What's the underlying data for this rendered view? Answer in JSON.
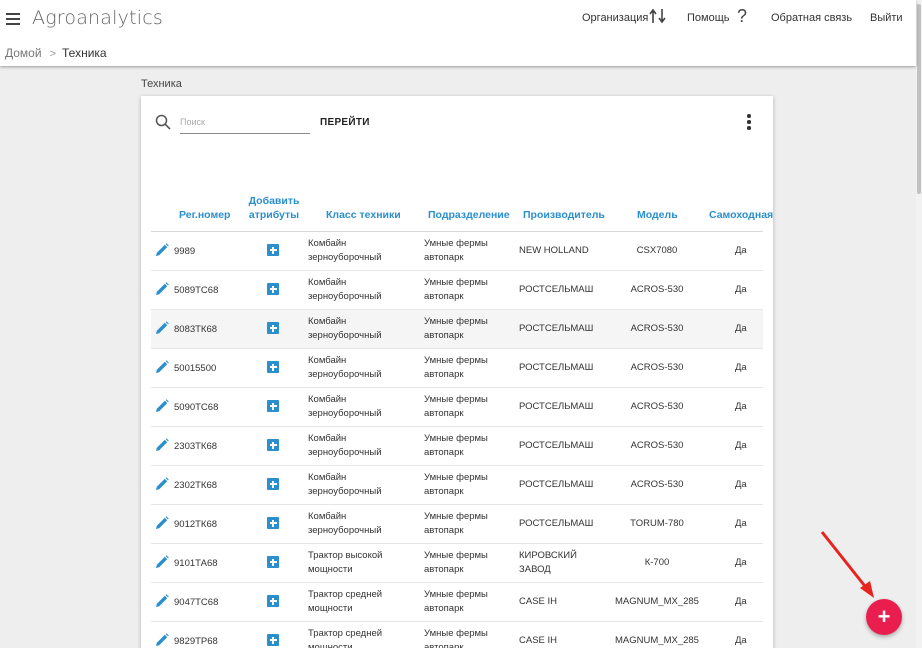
{
  "header": {
    "app_title": "Agroanalytics",
    "nav": {
      "organization": "Организация",
      "help": "Помощь",
      "help_glyph": "?",
      "feedback": "Обратная связь",
      "logout": "Выйти"
    }
  },
  "breadcrumb": {
    "home": "Домой",
    "separator": ">",
    "current": "Техника"
  },
  "section_label": "Техника",
  "toolbar": {
    "search_placeholder": "Поиск",
    "go_label": "ПЕРЕЙТИ"
  },
  "table": {
    "columns": {
      "reg": "Рег.номер",
      "add_attr_line1": "Добавить",
      "add_attr_line2": "атрибуты",
      "class": "Класс техники",
      "division": "Подразделение",
      "manufacturer": "Производитель",
      "model": "Модель",
      "self_propelled": "Самоходная"
    },
    "rows": [
      {
        "reg": "9989",
        "class1": "Комбайн",
        "class2": "зерноуборочный",
        "div1": "Умные фермы",
        "div2": "автопарк",
        "mfr1": "NEW HOLLAND",
        "mfr2": "",
        "model": "CSX7080",
        "self": "Да"
      },
      {
        "reg": "5089ТС68",
        "class1": "Комбайн",
        "class2": "зерноуборочный",
        "div1": "Умные фермы",
        "div2": "автопарк",
        "mfr1": "РОСТСЕЛЬМАШ",
        "mfr2": "",
        "model": "ACROS-530",
        "self": "Да"
      },
      {
        "reg": "8083ТК68",
        "class1": "Комбайн",
        "class2": "зерноуборочный",
        "div1": "Умные фермы",
        "div2": "автопарк",
        "mfr1": "РОСТСЕЛЬМАШ",
        "mfr2": "",
        "model": "ACROS-530",
        "self": "Да"
      },
      {
        "reg": "50015500",
        "class1": "Комбайн",
        "class2": "зерноуборочный",
        "div1": "Умные фермы",
        "div2": "автопарк",
        "mfr1": "РОСТСЕЛЬМАШ",
        "mfr2": "",
        "model": "ACROS-530",
        "self": "Да"
      },
      {
        "reg": "5090ТС68",
        "class1": "Комбайн",
        "class2": "зерноуборочный",
        "div1": "Умные фермы",
        "div2": "автопарк",
        "mfr1": "РОСТСЕЛЬМАШ",
        "mfr2": "",
        "model": "ACROS-530",
        "self": "Да"
      },
      {
        "reg": "2303ТК68",
        "class1": "Комбайн",
        "class2": "зерноуборочный",
        "div1": "Умные фермы",
        "div2": "автопарк",
        "mfr1": "РОСТСЕЛЬМАШ",
        "mfr2": "",
        "model": "ACROS-530",
        "self": "Да"
      },
      {
        "reg": "2302ТК68",
        "class1": "Комбайн",
        "class2": "зерноуборочный",
        "div1": "Умные фермы",
        "div2": "автопарк",
        "mfr1": "РОСТСЕЛЬМАШ",
        "mfr2": "",
        "model": "ACROS-530",
        "self": "Да"
      },
      {
        "reg": "9012ТК68",
        "class1": "Комбайн",
        "class2": "зерноуборочный",
        "div1": "Умные фермы",
        "div2": "автопарк",
        "mfr1": "РОСТСЕЛЬМАШ",
        "mfr2": "",
        "model": "TORUM-780",
        "self": "Да"
      },
      {
        "reg": "9101ТА68",
        "class1": "Трактор высокой",
        "class2": "мощности",
        "div1": "Умные фермы",
        "div2": "автопарк",
        "mfr1": "КИРОВСКИЙ",
        "mfr2": "ЗАВОД",
        "model": "К-700",
        "self": "Да"
      },
      {
        "reg": "9047ТС68",
        "class1": "Трактор средней",
        "class2": "мощности",
        "div1": "Умные фермы",
        "div2": "автопарк",
        "mfr1": "CASE IH",
        "mfr2": "",
        "model": "MAGNUM_MX_285",
        "self": "Да"
      },
      {
        "reg": "9829ТР68",
        "class1": "Трактор средней",
        "class2": "мощности",
        "div1": "Умные фермы",
        "div2": "автопарк",
        "mfr1": "CASE IH",
        "mfr2": "",
        "model": "MAGNUM_MX_285",
        "self": "Да"
      }
    ]
  },
  "fab": {
    "glyph": "+"
  },
  "colors": {
    "accent": "#2b8fce",
    "fab": "#e91e4f",
    "annotation_arrow": "#e8231f"
  }
}
